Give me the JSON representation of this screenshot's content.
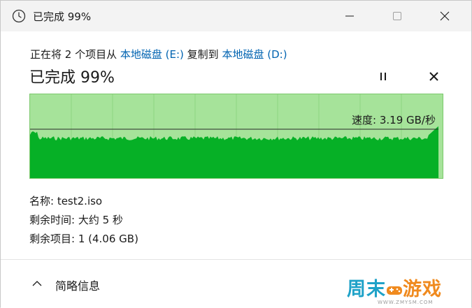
{
  "window": {
    "title": "已完成 99%",
    "icon": "clock-icon",
    "controls": [
      "minimize-icon",
      "maximize-icon",
      "close-icon"
    ]
  },
  "copy": {
    "prefix": "正在将 2 个项目从",
    "source": "本地磁盘 (E:)",
    "middle": "复制到",
    "destination": "本地磁盘 (D:)"
  },
  "status": {
    "label": "已完成 99%",
    "progress_percent": 99
  },
  "graph": {
    "speed_label": "速度: 3.19 GB/秒",
    "speed_value": 3.19,
    "speed_unit": "GB/秒",
    "colors": {
      "background": "#a6e39a",
      "fill": "#06b026",
      "line": "#2b2b2b"
    }
  },
  "details": {
    "name": "名称:  test2.iso",
    "time_left": "剩余时间:  大约 5 秒",
    "items_left": "剩余项目:  1 (4.06 GB)"
  },
  "footer": {
    "toggle_label": "简略信息",
    "toggle_icon": "chevron-up-icon"
  },
  "watermark": {
    "main_a": "周末",
    "main_b": "游戏",
    "sub": "WWW.ZMYSM.COM",
    "icon": "gamepad-icon"
  }
}
